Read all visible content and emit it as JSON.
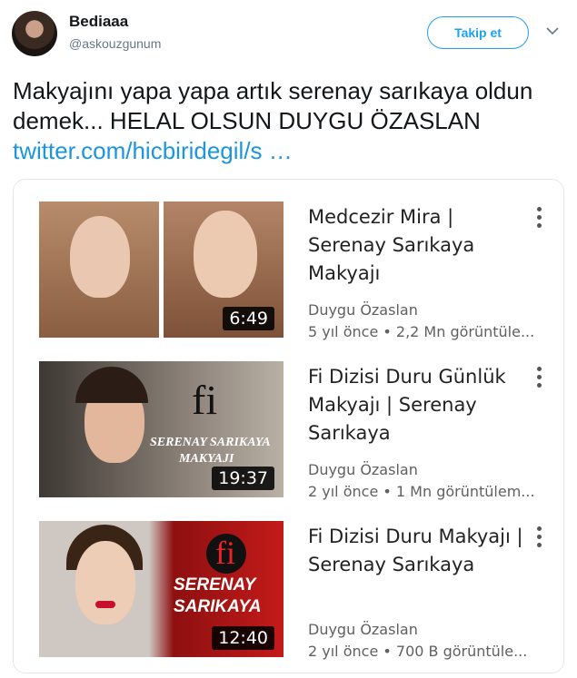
{
  "user": {
    "name": "Bediaaa",
    "handle": "@askouzgunum"
  },
  "follow_label": "Takip et",
  "tweet": {
    "text": "Makyajını yapa yapa artık serenay sarıkaya oldun demek... HELAL OLSUN DUYGU ÖZASLAN",
    "link": "twitter.com/hicbiridegil/s …"
  },
  "videos": [
    {
      "title": "Medcezir Mira | Serenay Sarıkaya Makyajı",
      "channel": "Duygu Özaslan",
      "meta": "5 yıl önce • 2,2 Mn görüntüle...",
      "duration": "6:49"
    },
    {
      "title": "Fi Dizisi Duru Günlük Makyajı | Serenay Sarıkaya",
      "channel": "Duygu Özaslan",
      "meta": "2 yıl önce • 1 Mn görüntülem...",
      "duration": "19:37",
      "thumb_logo": "fi",
      "thumb_caption_1": "SERENAY SARIKAYA",
      "thumb_caption_2": "MAKYAJI"
    },
    {
      "title": "Fi Dizisi Duru Makyajı | Serenay Sarıkaya",
      "channel": "Duygu Özaslan",
      "meta": "2 yıl önce • 700 B görüntüle...",
      "duration": "12:40",
      "thumb_logo": "fi",
      "thumb_caption_1": "SERENAY",
      "thumb_caption_2": "SARIKAYA"
    }
  ],
  "colors": {
    "accent": "#1da1f2",
    "link": "#1b95e0",
    "lipstick": "#c8102e"
  }
}
